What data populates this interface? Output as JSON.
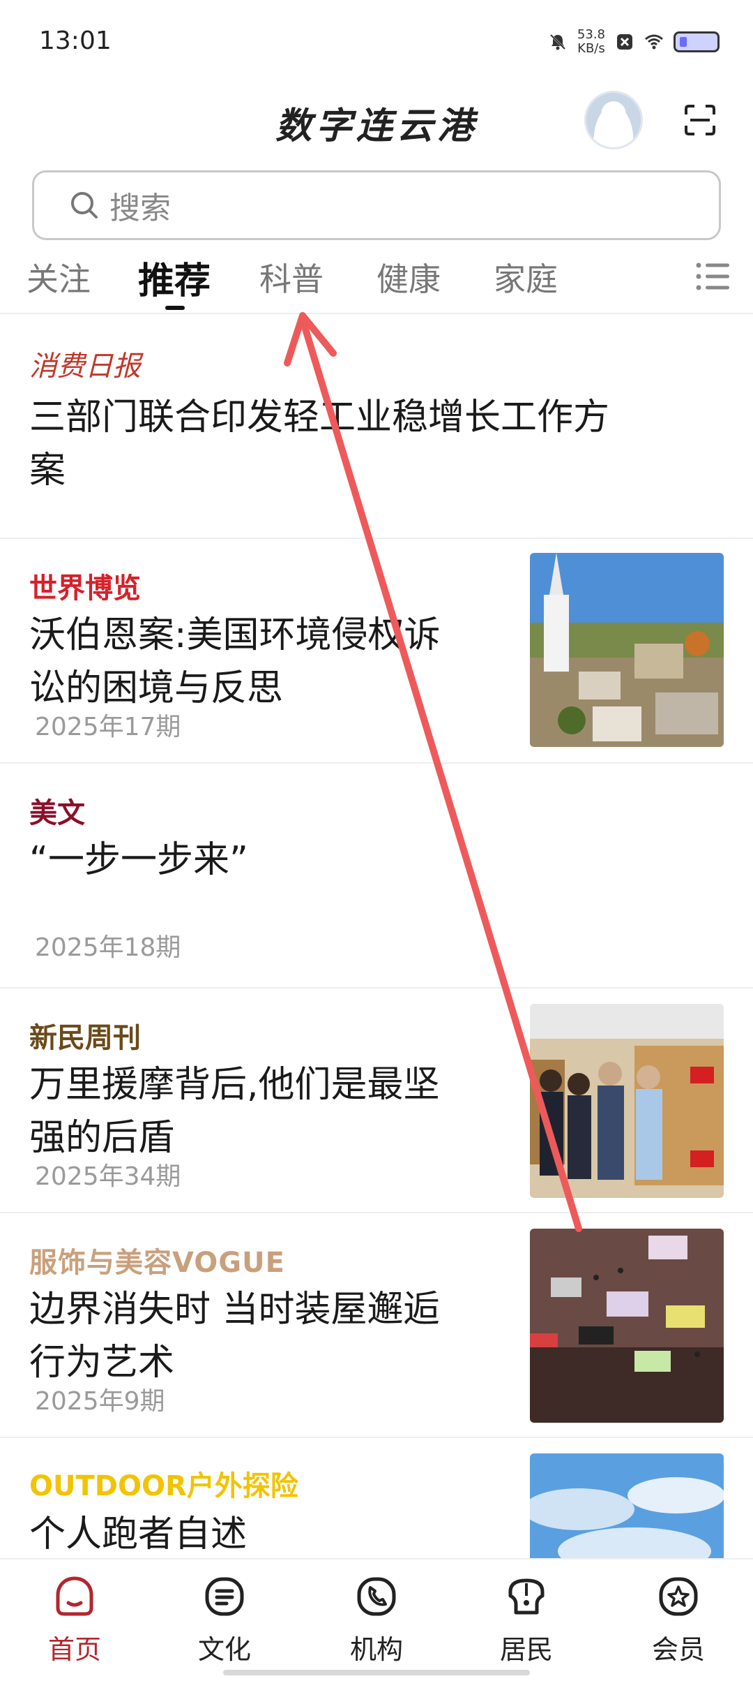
{
  "status_bar": {
    "time": "13:01",
    "net_speed_value": "53.8",
    "net_speed_unit": "KB/s"
  },
  "header": {
    "app_title": "数字连云港"
  },
  "search": {
    "placeholder": "搜索"
  },
  "tabs": [
    {
      "label": "关注",
      "active": false
    },
    {
      "label": "推荐",
      "active": true
    },
    {
      "label": "科普",
      "active": false
    },
    {
      "label": "健康",
      "active": false
    },
    {
      "label": "家庭",
      "active": false
    }
  ],
  "articles": [
    {
      "source": "消费日报",
      "title_line1": "三部门联合印发轻工业稳增长工作方",
      "title_line2": "案",
      "issue": "",
      "thumb": "none"
    },
    {
      "source": "世界博览",
      "title_line1": "沃伯恩案:美国环境侵权诉",
      "title_line2": "讼的困境与反思",
      "issue": "2025年17期",
      "thumb": "town-church-aerial"
    },
    {
      "source": "美文",
      "title_line1": "“一步一步来”",
      "title_line2": "",
      "issue": "2025年18期",
      "thumb": "none"
    },
    {
      "source": "新民周刊",
      "title_line1": "万里援摩背后,他们是最坚",
      "title_line2": "强的后盾",
      "issue": "2025年34期",
      "thumb": "group-photo-warehouse"
    },
    {
      "source": "服饰与美容VOGUE",
      "title_line1": "边界消失时 当时装屋邂逅",
      "title_line2": "行为艺术",
      "issue": "2025年9期",
      "thumb": "art-installation-screens"
    },
    {
      "source": "OUTDOOR户外探险",
      "title_line1": "个人跑者自述",
      "title_line2": "",
      "issue": "",
      "thumb": "blue-sky-clouds"
    }
  ],
  "bottom_nav": [
    {
      "label": "首页",
      "icon": "home-icon",
      "active": true
    },
    {
      "label": "文化",
      "icon": "document-icon",
      "active": false
    },
    {
      "label": "机构",
      "icon": "phone-icon",
      "active": false
    },
    {
      "label": "居民",
      "icon": "residents-icon",
      "active": false
    },
    {
      "label": "会员",
      "icon": "member-star-icon",
      "active": false
    }
  ],
  "colors": {
    "brand_red": "#b3262d",
    "source_consumer": "#c0392b",
    "source_world": "#d6202a",
    "source_meiwen": "#8b0f2a",
    "source_xinmin": "#6b4a1a",
    "source_vogue": "#c9a07c",
    "source_outdoor": "#f2c300",
    "swipe_arrow": "#ee5a5a"
  }
}
